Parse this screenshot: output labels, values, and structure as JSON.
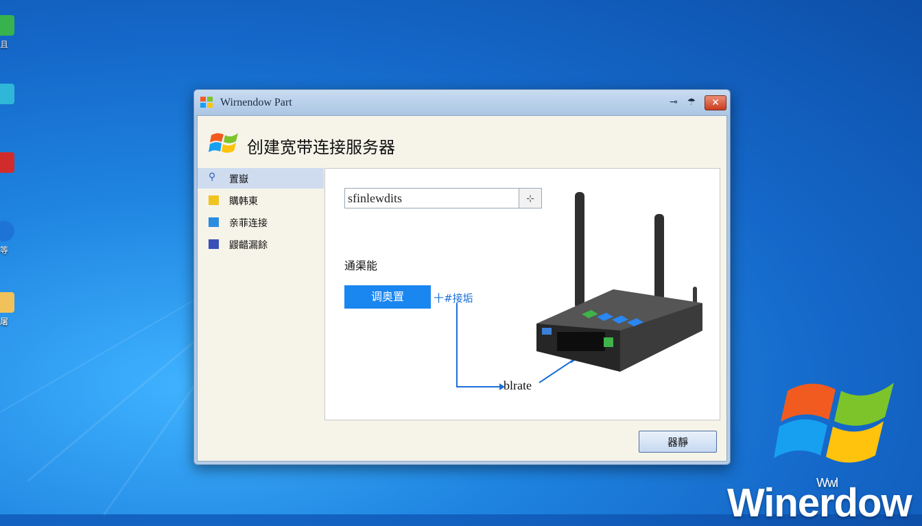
{
  "desktop": {
    "icons": [
      {
        "label": "且",
        "icon": "green-app-icon",
        "color": "#37b24d"
      },
      {
        "label": "",
        "icon": "app-icon",
        "color": "#2fb7d8"
      },
      {
        "label": "",
        "icon": "red-app-icon",
        "color": "#d22b2b"
      },
      {
        "label": "等",
        "icon": "ie-icon",
        "color": "#1e74d6"
      },
      {
        "label": "屠",
        "icon": "folder-icon",
        "color": "#f2c25a"
      }
    ],
    "brand_text": "Winerdow",
    "brand_small": "Wwl"
  },
  "window": {
    "title": "Wirnendow Part",
    "header_title": "创建宽带连接服务器",
    "sidebar": [
      {
        "label": "置嶽",
        "icon": "runner-icon",
        "color": "#2a5db3",
        "selected": true
      },
      {
        "label": "購韩東",
        "icon": "yellow-square-icon",
        "color": "#f0c320",
        "selected": false
      },
      {
        "label": "亲菲连接",
        "icon": "blue-screen-icon",
        "color": "#2a8de0",
        "selected": false
      },
      {
        "label": "鼹齰漏餘",
        "icon": "network-icon",
        "color": "#3a4fb8",
        "selected": false
      }
    ],
    "input": {
      "value": "sfinlewdits",
      "button": "⊹"
    },
    "section_label": "通渠能",
    "primary_button": "调奥置",
    "link_text": "十#接垢",
    "callout_label": "blrate",
    "ok_button": "器靜"
  }
}
